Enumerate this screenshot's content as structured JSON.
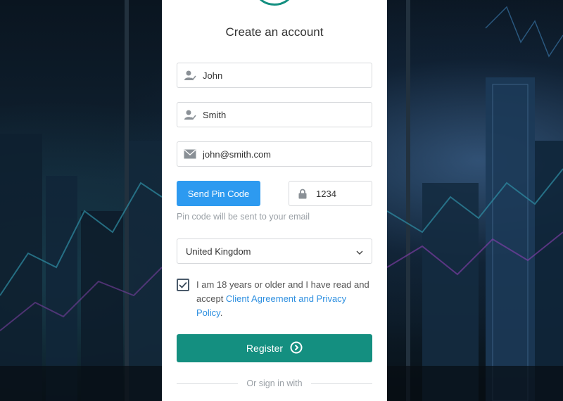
{
  "form": {
    "title": "Create an account",
    "first_name": {
      "value": "John",
      "icon": "user-icon"
    },
    "last_name": {
      "value": "Smith",
      "icon": "user-icon"
    },
    "email": {
      "value": "john@smith.com",
      "icon": "envelope-icon"
    },
    "send_pin_label": "Send Pin Code",
    "pin": {
      "value": "1234",
      "icon": "lock-icon"
    },
    "pin_hint": "Pin code will be sent to your email",
    "country": {
      "selected": "United Kingdom"
    },
    "consent": {
      "checked": true,
      "text_before": "I am 18 years or older and I have read and accept ",
      "link_text": "Client Agreement and Privacy Policy",
      "text_after": "."
    },
    "register_label": "Register",
    "divider_text": "Or sign in with"
  },
  "colors": {
    "primary": "#148f80",
    "pin_button": "#2d9af0",
    "link": "#2d8fe0"
  }
}
